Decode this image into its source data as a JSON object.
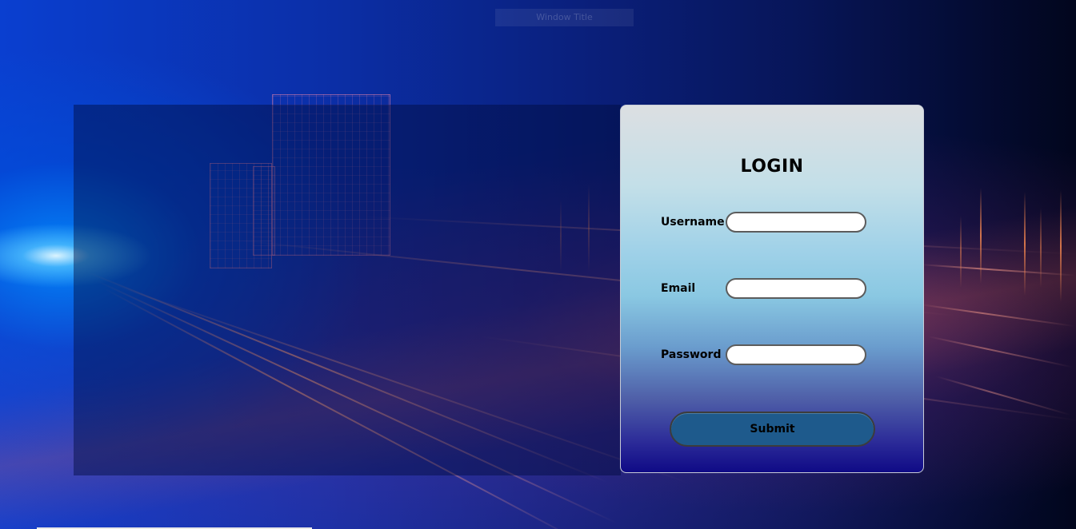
{
  "window": {
    "title": "Window Title"
  },
  "login": {
    "title": "LOGIN",
    "fields": [
      {
        "label": "Username",
        "value": "",
        "placeholder": ""
      },
      {
        "label": "Email",
        "value": "",
        "placeholder": ""
      },
      {
        "label": "Password",
        "value": "",
        "placeholder": ""
      }
    ],
    "submit_label": "Submit"
  },
  "colors": {
    "submit_button": "#1e5a8c",
    "card_top": "#dcdfe2",
    "card_bottom": "#0f0a86"
  }
}
